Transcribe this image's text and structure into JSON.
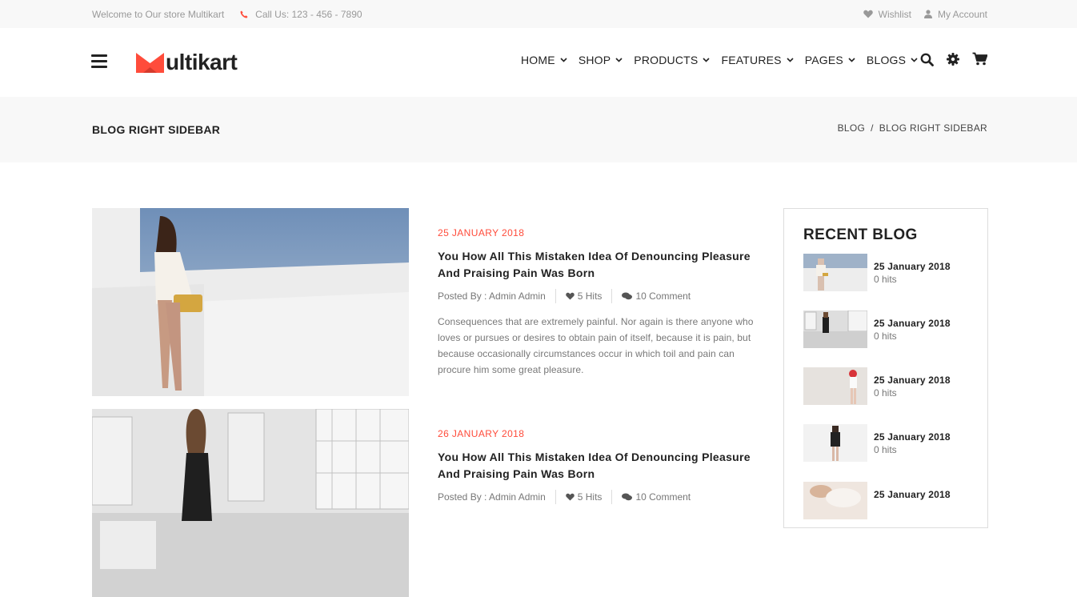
{
  "topbar": {
    "welcome": "Welcome to Our store Multikart",
    "phone": "Call Us: 123 - 456 - 7890",
    "wishlist": "Wishlist",
    "account": "My Account"
  },
  "header": {
    "logo_text": "ultikart",
    "nav": [
      {
        "label": "HOME"
      },
      {
        "label": "SHOP"
      },
      {
        "label": "PRODUCTS"
      },
      {
        "label": "FEATURES"
      },
      {
        "label": "PAGES"
      },
      {
        "label": "BLOGS"
      }
    ],
    "icons": [
      "search-icon",
      "gear-icon",
      "cart-icon"
    ]
  },
  "breadcrumb": {
    "page_title": "BLOG RIGHT SIDEBAR",
    "items": [
      "BLOG",
      "BLOG RIGHT SIDEBAR"
    ],
    "separator": "/"
  },
  "posts": [
    {
      "date": "25 JANUARY 2018",
      "title": "You How All This Mistaken Idea Of Denouncing Pleasure And Praising Pain Was Born",
      "author": "Posted By : Admin Admin",
      "hits": "5 Hits",
      "comments": "10 Comment",
      "excerpt": "Consequences that are extremely painful. Nor again is there anyone who loves or pursues or desires to obtain pain of itself, because it is pain, but because occasionally circumstances occur in which toil and pain can procure him some great pleasure."
    },
    {
      "date": "26 JANUARY 2018",
      "title": "You How All This Mistaken Idea Of Denouncing Pleasure And Praising Pain Was Born",
      "author": "Posted By : Admin Admin",
      "hits": "5 Hits",
      "comments": "10 Comment"
    }
  ],
  "sidebar": {
    "title": "RECENT BLOG",
    "items": [
      {
        "date": "25 January 2018",
        "hits": "0 hits"
      },
      {
        "date": "25 January 2018",
        "hits": "0 hits"
      },
      {
        "date": "25 January 2018",
        "hits": "0 hits"
      },
      {
        "date": "25 January 2018",
        "hits": "0 hits"
      },
      {
        "date": "25 January 2018",
        "hits": ""
      }
    ]
  },
  "colors": {
    "accent": "#ff4c3b",
    "text": "#222222",
    "muted": "#777777",
    "band": "#f8f8f8"
  }
}
